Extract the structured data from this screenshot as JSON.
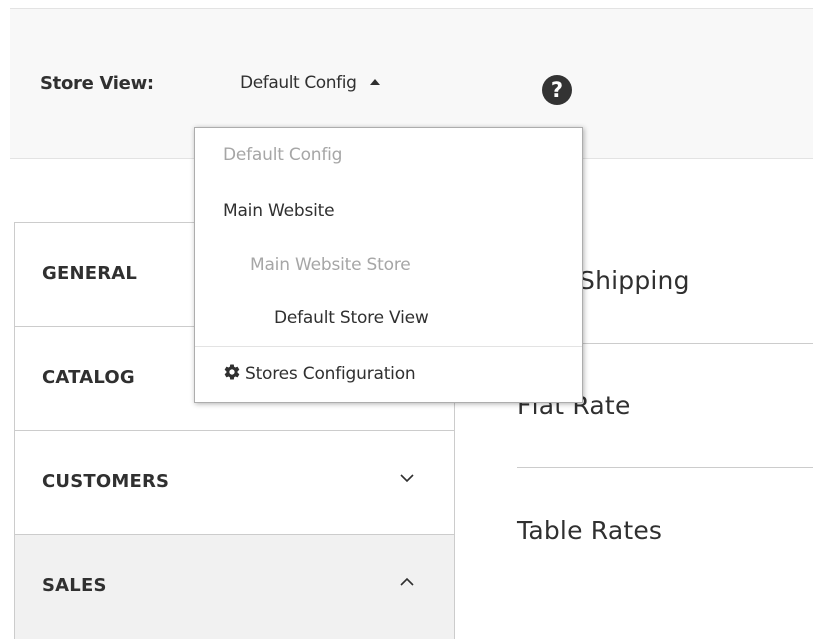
{
  "store_switcher": {
    "label": "Store View:",
    "current": "Default Config",
    "help_glyph": "?",
    "options": [
      {
        "label": "Default Config",
        "disabled": true
      },
      {
        "label": "Main Website",
        "disabled": false
      },
      {
        "label": "Main Website Store",
        "disabled": true
      },
      {
        "label": "Default Store View",
        "disabled": false
      }
    ],
    "manage_link": "Stores Configuration"
  },
  "nav": {
    "items": [
      {
        "label": "GENERAL",
        "expanded": false
      },
      {
        "label": "CATALOG",
        "expanded": false
      },
      {
        "label": "CUSTOMERS",
        "expanded": false
      },
      {
        "label": "SALES",
        "expanded": true
      }
    ]
  },
  "content": {
    "sections": [
      "Free Shipping",
      "Flat Rate",
      "Table Rates"
    ]
  },
  "icons": {
    "dropdown_caret": "caret-up-icon",
    "help": "help-icon",
    "manage": "gear-icon",
    "collapsed": "chevron-down-icon",
    "expanded": "chevron-up-icon"
  }
}
